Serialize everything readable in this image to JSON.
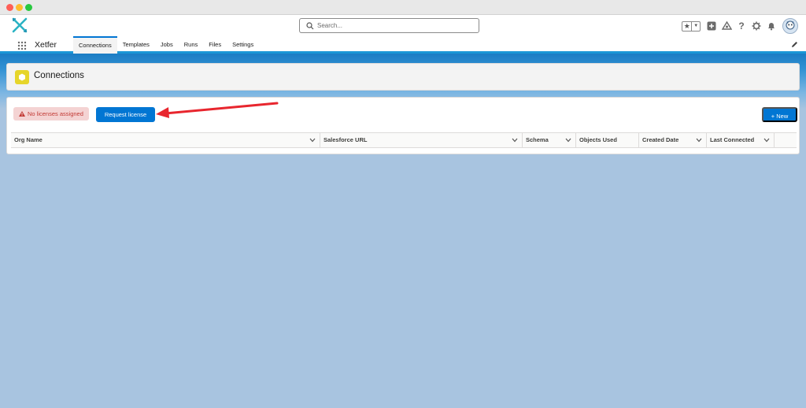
{
  "header": {
    "app_name": "Xetfer",
    "search_placeholder": "Search..."
  },
  "nav": {
    "tabs": [
      {
        "label": "Connections",
        "active": true
      },
      {
        "label": "Templates"
      },
      {
        "label": "Jobs"
      },
      {
        "label": "Runs"
      },
      {
        "label": "Files"
      },
      {
        "label": "Settings"
      }
    ]
  },
  "page": {
    "title": "Connections",
    "license_status": "No licenses assigned",
    "request_license_label": "Request license",
    "new_button_label": "+ New"
  },
  "table": {
    "columns": [
      {
        "label": "Org Name",
        "sortable": true
      },
      {
        "label": "Salesforce URL",
        "sortable": true
      },
      {
        "label": "Schema",
        "sortable": true
      },
      {
        "label": "Objects Used",
        "sortable": false
      },
      {
        "label": "Created Date",
        "sortable": true
      },
      {
        "label": "Last Connected",
        "sortable": true
      }
    ]
  },
  "colors": {
    "brand_blue": "#0176d3",
    "header_band": "#1b96d6",
    "background": "#a8c4e0",
    "error_text": "#c23934",
    "error_bg": "#f4d3d3",
    "annotation_arrow": "#e8262e"
  }
}
